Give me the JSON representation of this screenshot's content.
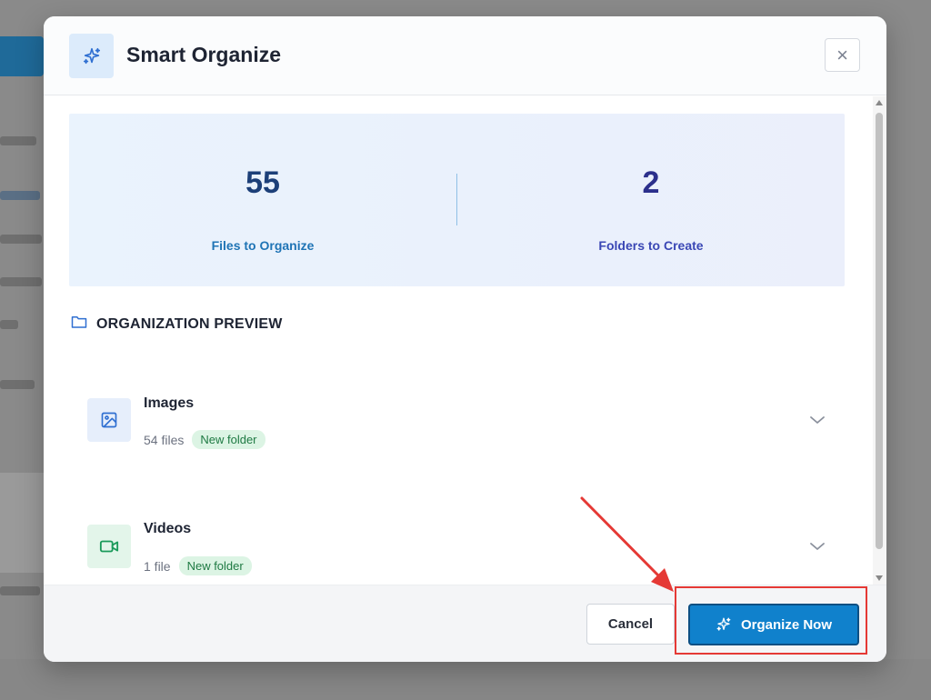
{
  "modal": {
    "title": "Smart Organize",
    "close_symbol": "×",
    "header_icon": "sparkle-icon"
  },
  "stats": {
    "files": {
      "value": "55",
      "label": "Files to Organize"
    },
    "folders": {
      "value": "2",
      "label": "Folders to Create"
    }
  },
  "preview": {
    "title": "ORGANIZATION PREVIEW",
    "icon": "folder-icon",
    "folders": [
      {
        "name": "Images",
        "count": "54 files",
        "badge": "New folder",
        "icon": "image-icon",
        "icon_color": "#2f6fd1",
        "icon_bg": "#e6eefb"
      },
      {
        "name": "Videos",
        "count": "1 file",
        "badge": "New folder",
        "icon": "video-icon",
        "icon_color": "#1a9a5a",
        "icon_bg": "#e3f5ea"
      }
    ]
  },
  "footer": {
    "cancel_label": "Cancel",
    "organize_label": "Organize Now"
  },
  "colors": {
    "primary": "#1081cc",
    "annotation": "#e53935",
    "badge_bg": "#dcf4e4",
    "badge_text": "#1f7a43"
  }
}
